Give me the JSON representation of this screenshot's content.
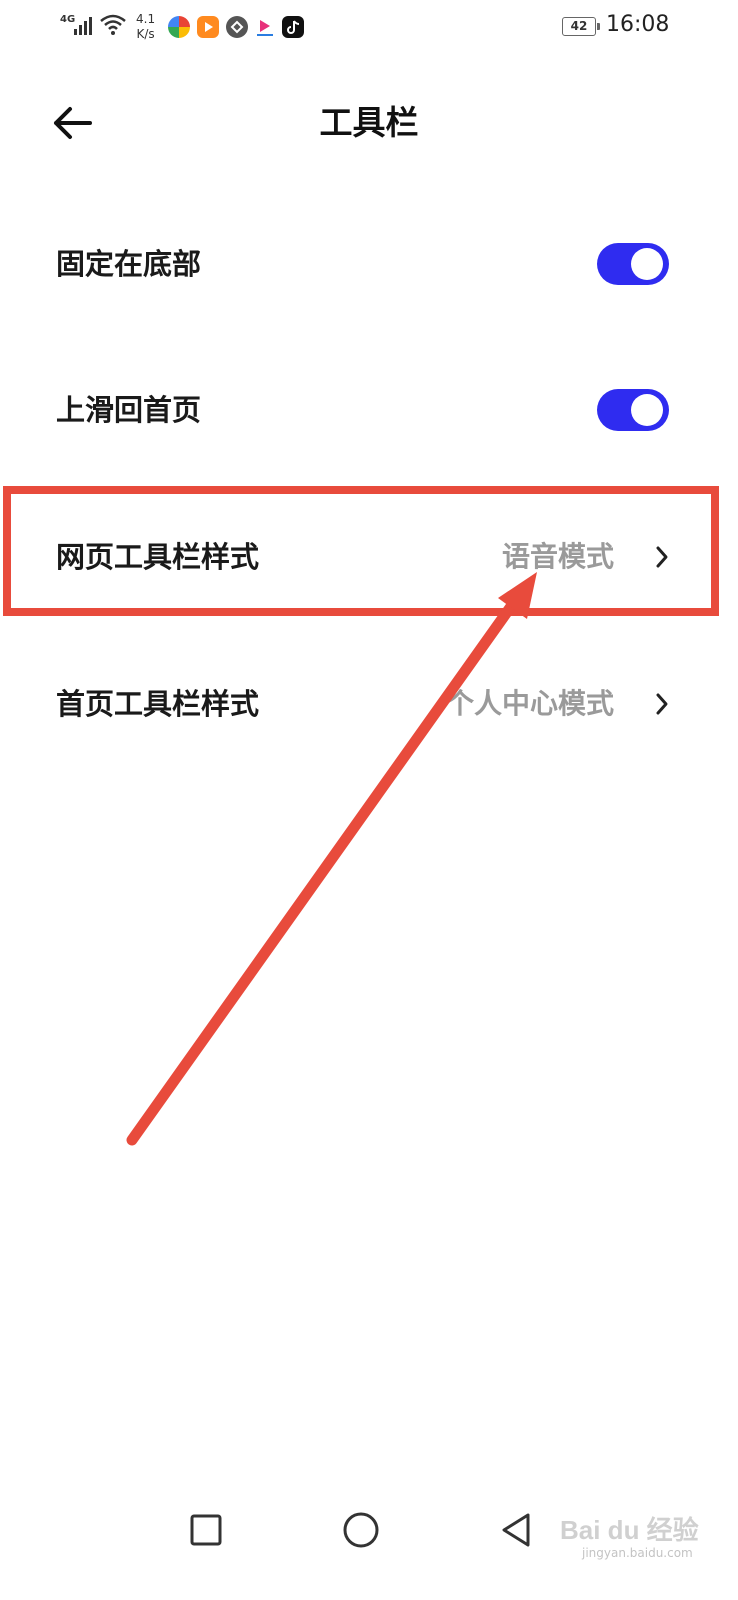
{
  "status_bar": {
    "network": "4G",
    "speed_value": "4.1",
    "speed_unit": "K/s",
    "battery": "42",
    "time": "16:08"
  },
  "header": {
    "title": "工具栏",
    "back_icon": "arrow-left-icon"
  },
  "settings": [
    {
      "label": "固定在底部",
      "type": "toggle",
      "checked": true
    },
    {
      "label": "上滑回首页",
      "type": "toggle",
      "checked": true
    },
    {
      "label": "网页工具栏样式",
      "type": "link",
      "value": "语音模式"
    },
    {
      "label": "首页工具栏样式",
      "type": "link",
      "value": "个人中心模式"
    }
  ],
  "colors": {
    "accent": "#2f2cf0",
    "annotation": "#e84b3c",
    "value_text": "#9a9a9a"
  },
  "watermark": {
    "brand": "Bai du 经验",
    "site": "jingyan.baidu.com"
  }
}
